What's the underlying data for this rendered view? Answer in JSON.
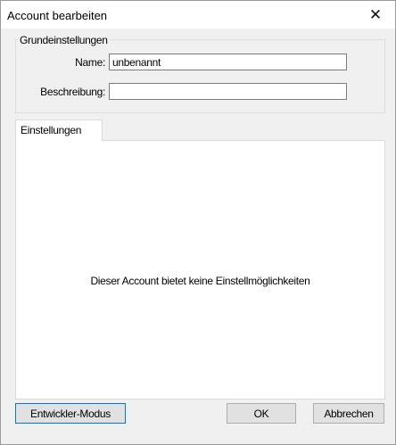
{
  "window": {
    "title": "Account bearbeiten",
    "close_symbol": "✕"
  },
  "basic_settings": {
    "legend": "Grundeinstellungen",
    "name_label": "Name:",
    "name_value": "unbenannt",
    "description_label": "Beschreibung:",
    "description_value": ""
  },
  "tabs": [
    {
      "label": "Einstellungen"
    }
  ],
  "settings_panel": {
    "message": "Dieser Account bietet keine Einstellmöglichkeiten"
  },
  "buttons": {
    "developer_mode": "Entwickler-Modus",
    "ok": "OK",
    "cancel": "Abbrechen"
  }
}
